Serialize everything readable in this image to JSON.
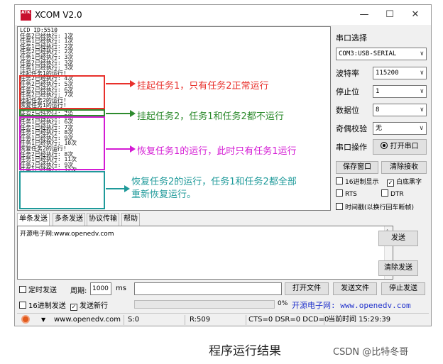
{
  "window": {
    "title": "XCOM V2.0",
    "icon_text": "ATK XCOM",
    "minimize": "—",
    "maximize": "☐",
    "close": "✕"
  },
  "receive": {
    "lines": [
      "LCD ID:5510",
      "任务2已经执行: 1次",
      "任务1已经执行: 1次",
      "任务1已经执行: 2次",
      "任务2已经执行: 2次",
      "任务1已经执行: 3次",
      "任务2已经执行: 3次",
      "任务1已经执行: 3次",
      "挂起任务1的运行!",
      "任务2已经执行: 4次",
      "任务2已经执行: 5次",
      "任务2已经执行: 6次",
      "任务2已经执行: 7次",
      "挂起任务2的运行!",
      "恢复任务1的运行!",
      "任务1已经执行: 4次",
      "任务1已经执行: 5次",
      "任务1已经执行: 6次",
      "任务1已经执行: 7次",
      "任务1已经执行: 8次",
      "任务1已经执行: 9次",
      "任务1已经执行: 10次",
      "恢复任务2的运行!",
      "任务2已经执行: 8次",
      "任务1已经执行: 11次",
      "任务2已经执行: 9次",
      "任务1已经执行: 12次"
    ]
  },
  "annotations": {
    "a1": "挂起任务1，只有任务2正常运行",
    "a2": "挂起任务2，任务1和任务2都不运行",
    "a3": "恢复任务1的运行，此时只有任务1运行",
    "a4_line1": "恢复任务2的运行，任务1和任务2都全部",
    "a4_line2": "重新恢复运行。",
    "colors": {
      "a1": "#e8302b",
      "a2": "#2e8b2e",
      "a3": "#d41bd4",
      "a4": "#1f9a9a"
    }
  },
  "sidebar": {
    "port_label": "串口选择",
    "port_value": "COM3:USB-SERIAL",
    "baud_label": "波特率",
    "baud_value": "115200",
    "stop_label": "停止位",
    "stop_value": "1",
    "data_label": "数据位",
    "data_value": "8",
    "parity_label": "奇偶校验",
    "parity_value": "无",
    "op_label": "串口操作",
    "open_button": "打开串口",
    "save_window": "保存窗口",
    "clear_receive": "清除接收",
    "hex_display": "16进制显示",
    "white_bg": "白底黑字",
    "rts": "RTS",
    "dtr": "DTR",
    "timestamp": "时间戳(以换行回车断帧)"
  },
  "tabs": [
    "单条发送",
    "多条发送",
    "协议传输",
    "帮助"
  ],
  "send": {
    "text": "开源电子网:www.openedv.com",
    "send_button": "发送",
    "clear_send": "清除发送",
    "timed_send": "定时发送",
    "period_label": "周期:",
    "period_value": "1000",
    "period_unit": "ms",
    "open_file": "打开文件",
    "send_file": "发送文件",
    "stop_send": "停止发送",
    "hex_send": "16进制发送",
    "send_newline": "发送新行",
    "progress": "0%",
    "progress_value": 0,
    "site_banner": "开源电子网: www.openedv.com"
  },
  "status": {
    "url": "www.openedv.com",
    "s": "S:0",
    "r": "R:509",
    "lines": "CTS=0 DSR=0 DCD=0",
    "time": "当前时间 15:29:39"
  },
  "caption": "程序运行结果",
  "watermark": "CSDN @比特冬哥"
}
